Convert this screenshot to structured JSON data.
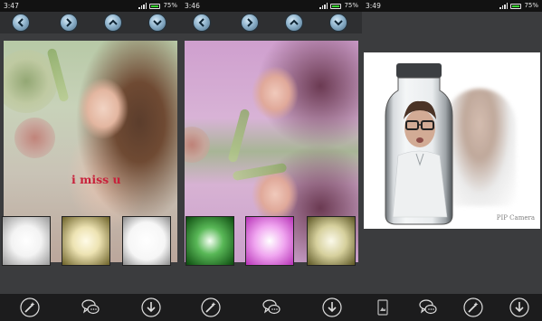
{
  "screens": [
    {
      "status": {
        "time": "3:47",
        "battery": "75%"
      },
      "caption": "i miss u",
      "toolbar_icons": [
        "arrow-left-icon",
        "arrow-right-icon",
        "arrow-up-icon",
        "arrow-down-icon"
      ],
      "thumbnails": [
        "white-vignette",
        "gold-vignette",
        "white-vignette"
      ],
      "bottom_icons": [
        "magic-wand-icon",
        "chat-bubbles-icon",
        "download-icon"
      ]
    },
    {
      "status": {
        "time": "3:46",
        "battery": "75%"
      },
      "toolbar_icons": [
        "arrow-left-icon",
        "arrow-right-icon",
        "arrow-up-icon",
        "arrow-down-icon"
      ],
      "thumbnails": [
        "green-vignette",
        "pink-vignette",
        "olive-vignette"
      ],
      "bottom_icons": [
        "magic-wand-icon",
        "chat-bubbles-icon",
        "download-icon"
      ]
    },
    {
      "status": {
        "time": "3:49",
        "battery": "75%"
      },
      "watermark": "PIP Camera",
      "bottom_icons": [
        "gallery-icon",
        "chat-bubbles-icon",
        "magic-wand-icon",
        "download-icon"
      ]
    }
  ],
  "colors": {
    "caption": "#c8203a",
    "battery": "#38d430",
    "toolbar": "#2e2f31",
    "bottom_bar": "#1c1c1d"
  }
}
